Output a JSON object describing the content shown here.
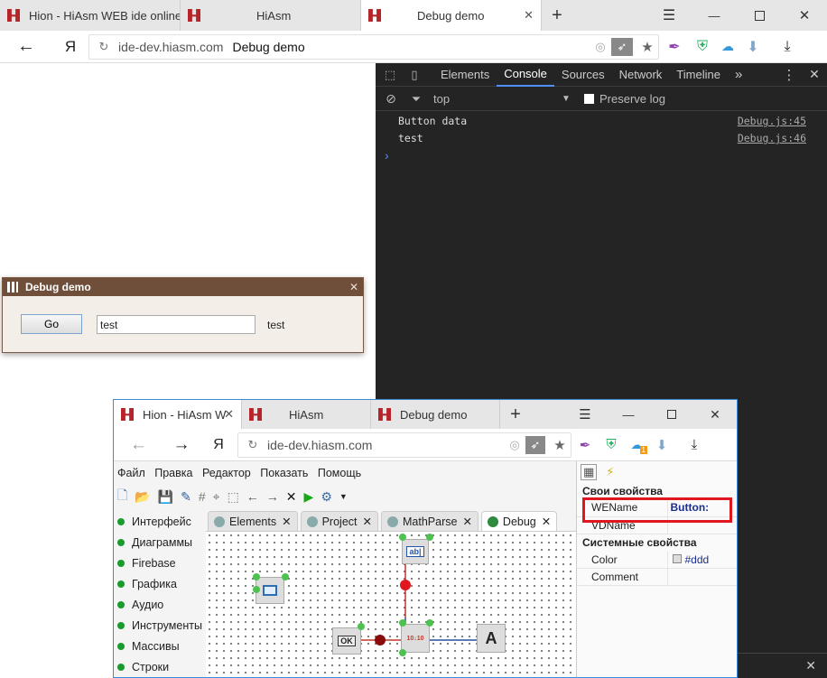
{
  "main_browser": {
    "tabs": [
      {
        "title": "Hion - HiAsm WEB ide online"
      },
      {
        "title": "HiAsm"
      },
      {
        "title": "Debug demo"
      }
    ],
    "url_domain": "ide-dev.hiasm.com",
    "url_title": "Debug demo"
  },
  "devtools": {
    "tabs": [
      "Elements",
      "Console",
      "Sources",
      "Network",
      "Timeline"
    ],
    "active_tab": "Console",
    "context": "top",
    "preserve_log_label": "Preserve log",
    "logs": [
      {
        "text": "Button data",
        "source": "Debug.js:45"
      },
      {
        "text": "test",
        "source": "Debug.js:46"
      }
    ],
    "prompt": "›"
  },
  "dialog": {
    "title": "Debug demo",
    "button_label": "Go",
    "input_value": "test",
    "output_label": "test"
  },
  "second_browser": {
    "tabs": [
      {
        "title": "Hion - HiAsm W"
      },
      {
        "title": "HiAsm"
      },
      {
        "title": "Debug demo"
      }
    ],
    "url_domain": "ide-dev.hiasm.com",
    "menu": [
      "Файл",
      "Правка",
      "Редактор",
      "Показать",
      "Помощь"
    ],
    "palette": [
      "Интерфейс",
      "Диаграммы",
      "Firebase",
      "Графика",
      "Аудио",
      "Инструменты",
      "Массивы",
      "Строки"
    ],
    "editor_tabs": [
      "Elements",
      "Project",
      "MathParse",
      "Debug"
    ],
    "active_editor_tab": "Debug",
    "props": {
      "own_header": "Свои свойства",
      "system_header": "Системные свойства",
      "rows": [
        {
          "name": "WEName",
          "value": "Button:"
        },
        {
          "name": "VDName",
          "value": ""
        }
      ],
      "system_rows": [
        {
          "name": "Color",
          "value": "#ddd"
        },
        {
          "name": "Comment",
          "value": ""
        }
      ]
    },
    "extension_badge": "1"
  },
  "colors": {
    "tabbar": "#e6e6e6",
    "devtools_bg": "#242424",
    "dialog_title": "#6f4f3a",
    "highlight": "#e0171f",
    "pin": "#4ec24e"
  }
}
